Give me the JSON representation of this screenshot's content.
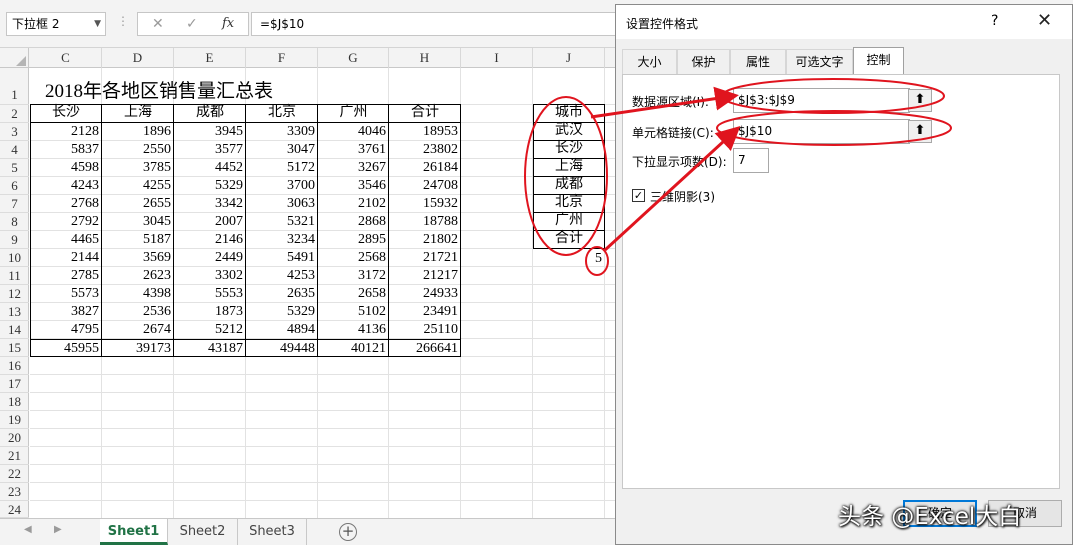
{
  "formula_bar": {
    "name_box": "下拉框 2",
    "cancel_glyph": "✕",
    "enter_glyph": "✓",
    "fx_label": "fx",
    "formula": "=$J$10"
  },
  "columns": [
    "C",
    "D",
    "E",
    "F",
    "G",
    "H",
    "I",
    "J"
  ],
  "rows": [
    "1",
    "2",
    "3",
    "4",
    "5",
    "6",
    "7",
    "8",
    "9",
    "10",
    "11",
    "12",
    "13",
    "14",
    "15",
    "16",
    "17",
    "18",
    "19",
    "20",
    "21",
    "22",
    "23",
    "24"
  ],
  "sheet": {
    "title": "2018年各地区销售量汇总表",
    "headers": [
      "长沙",
      "上海",
      "成都",
      "北京",
      "广州",
      "合计"
    ],
    "data": [
      [
        "2128",
        "1896",
        "3945",
        "3309",
        "4046",
        "18953"
      ],
      [
        "5837",
        "2550",
        "3577",
        "3047",
        "3761",
        "23802"
      ],
      [
        "4598",
        "3785",
        "4452",
        "5172",
        "3267",
        "26184"
      ],
      [
        "4243",
        "4255",
        "5329",
        "3700",
        "3546",
        "24708"
      ],
      [
        "2768",
        "2655",
        "3342",
        "3063",
        "2102",
        "15932"
      ],
      [
        "2792",
        "3045",
        "2007",
        "5321",
        "2868",
        "18788"
      ],
      [
        "4465",
        "5187",
        "2146",
        "3234",
        "2895",
        "21802"
      ],
      [
        "2144",
        "3569",
        "2449",
        "5491",
        "2568",
        "21721"
      ],
      [
        "2785",
        "2623",
        "3302",
        "4253",
        "3172",
        "21217"
      ],
      [
        "5573",
        "4398",
        "5553",
        "2635",
        "2658",
        "24933"
      ],
      [
        "3827",
        "2536",
        "1873",
        "5329",
        "5102",
        "23491"
      ],
      [
        "4795",
        "2674",
        "5212",
        "4894",
        "4136",
        "25110"
      ]
    ],
    "totals": [
      "45955",
      "39173",
      "43187",
      "49448",
      "40121",
      "266641"
    ],
    "list_range": [
      "城市",
      "武汉",
      "长沙",
      "上海",
      "成都",
      "北京",
      "广州",
      "合计"
    ],
    "linked_value": "5"
  },
  "sheet_tabs": [
    "Sheet1",
    "Sheet2",
    "Sheet3"
  ],
  "dialog": {
    "title": "设置控件格式",
    "help": "?",
    "close": "✕",
    "tabs": [
      "大小",
      "保护",
      "属性",
      "可选文字",
      "控制"
    ],
    "input_range_label": "数据源区域(I):",
    "input_range_value": "$J$3:$J$9",
    "cell_link_label": "单元格链接(C):",
    "cell_link_value": "$J$10",
    "dropdown_lines_label": "下拉显示项数(D):",
    "dropdown_lines_value": "7",
    "shading_label": "三维阴影(3)",
    "shading_checked": true,
    "ok_label": "确定",
    "cancel_label": "取消"
  },
  "watermark": "头条 @Excel大白",
  "colors": {
    "annotation": "#e0141e",
    "excel_green": "#217346",
    "accent": "#0078d7"
  }
}
